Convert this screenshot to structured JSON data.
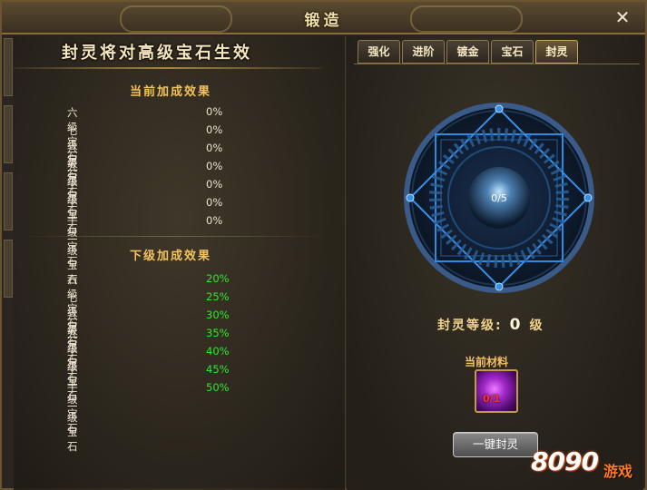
{
  "window": {
    "title": "锻造",
    "close_label": "✕"
  },
  "left_panel": {
    "headline": "封灵将对高级宝石生效",
    "current_section": {
      "title": "当前加成效果",
      "rows": [
        {
          "name": "六级宝石",
          "value": "0%"
        },
        {
          "name": "七级宝石",
          "value": "0%"
        },
        {
          "name": "八级宝石",
          "value": "0%"
        },
        {
          "name": "九级宝石",
          "value": "0%"
        },
        {
          "name": "十级宝石",
          "value": "0%"
        },
        {
          "name": "十一级宝石",
          "value": "0%"
        },
        {
          "name": "十二级宝石",
          "value": "0%"
        }
      ]
    },
    "next_section": {
      "title": "下级加成效果",
      "rows": [
        {
          "name": "六级宝石",
          "value": "20%"
        },
        {
          "name": "七级宝石",
          "value": "25%"
        },
        {
          "name": "八级宝石",
          "value": "30%"
        },
        {
          "name": "九级宝石",
          "value": "35%"
        },
        {
          "name": "十级宝石",
          "value": "40%"
        },
        {
          "name": "十一级宝石",
          "value": "45%"
        },
        {
          "name": "十二级宝石",
          "value": "50%"
        }
      ]
    }
  },
  "right_panel": {
    "tabs": [
      {
        "label": "强化",
        "active": false
      },
      {
        "label": "进阶",
        "active": false
      },
      {
        "label": "镀金",
        "active": false
      },
      {
        "label": "宝石",
        "active": false
      },
      {
        "label": "封灵",
        "active": true
      }
    ],
    "seal_progress": "0/5",
    "seal_level_label": "封灵等级:",
    "seal_level_value": "0",
    "seal_level_unit": "级",
    "material_title": "当前材料",
    "material_count": "0/1",
    "seal_button": "一键封灵"
  },
  "watermark": {
    "number": "8090",
    "text": "游戏"
  },
  "colors": {
    "gold_text": "#f2c25c",
    "green_value": "#2ee82e",
    "rune_blue": "#3a8fe8"
  }
}
